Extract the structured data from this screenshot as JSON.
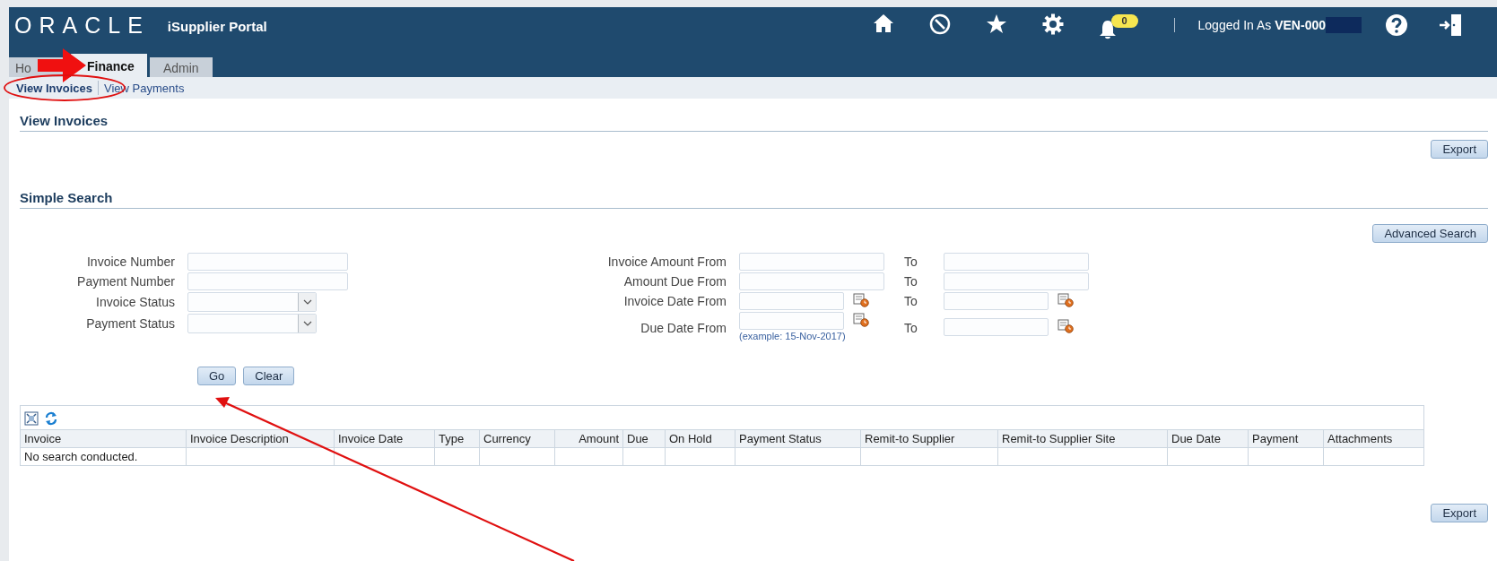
{
  "header": {
    "logo": "ORACLE",
    "app_title": "iSupplier Portal",
    "notification_count": "0",
    "user": "Logged In As **VEN-000**"
  },
  "tabs": [
    {
      "label": "Ho",
      "selected": false
    },
    {
      "label": "Finance",
      "selected": true
    },
    {
      "label": "Admin",
      "selected": false
    }
  ],
  "subtabs": [
    {
      "label": "View Invoices",
      "selected": true
    },
    {
      "label": "View Payments",
      "selected": false
    }
  ],
  "page_title": "View Invoices",
  "export_top": "Export",
  "search": {
    "title": "Simple Search",
    "advanced_button": "Advanced Search",
    "left_fields": [
      {
        "label": "Invoice Number",
        "kind": "text"
      },
      {
        "label": "Payment Number",
        "kind": "text"
      },
      {
        "label": "Invoice Status",
        "kind": "select"
      },
      {
        "label": "Payment Status",
        "kind": "select"
      }
    ],
    "right_fields": [
      {
        "label": "Invoice Amount From",
        "kind": "text",
        "to_label": "To"
      },
      {
        "label": "Amount Due From",
        "kind": "text",
        "to_label": "To"
      },
      {
        "label": "Invoice Date From",
        "kind": "date",
        "to_label": "To"
      },
      {
        "label": "Due Date From",
        "kind": "date",
        "to_label": "To",
        "hint": "(example: 15-Nov-2017)"
      }
    ],
    "buttons": [
      "Go",
      "Clear"
    ]
  },
  "table": {
    "columns": [
      "Invoice",
      "Invoice Description",
      "Invoice Date",
      "Type",
      "Currency",
      "Amount",
      "Due",
      "On Hold",
      "Payment Status",
      "Remit-to Supplier",
      "Remit-to Supplier Site",
      "Due Date",
      "Payment",
      "Attachments"
    ],
    "empty_message": "No search conducted."
  },
  "export_bottom": "Export"
}
